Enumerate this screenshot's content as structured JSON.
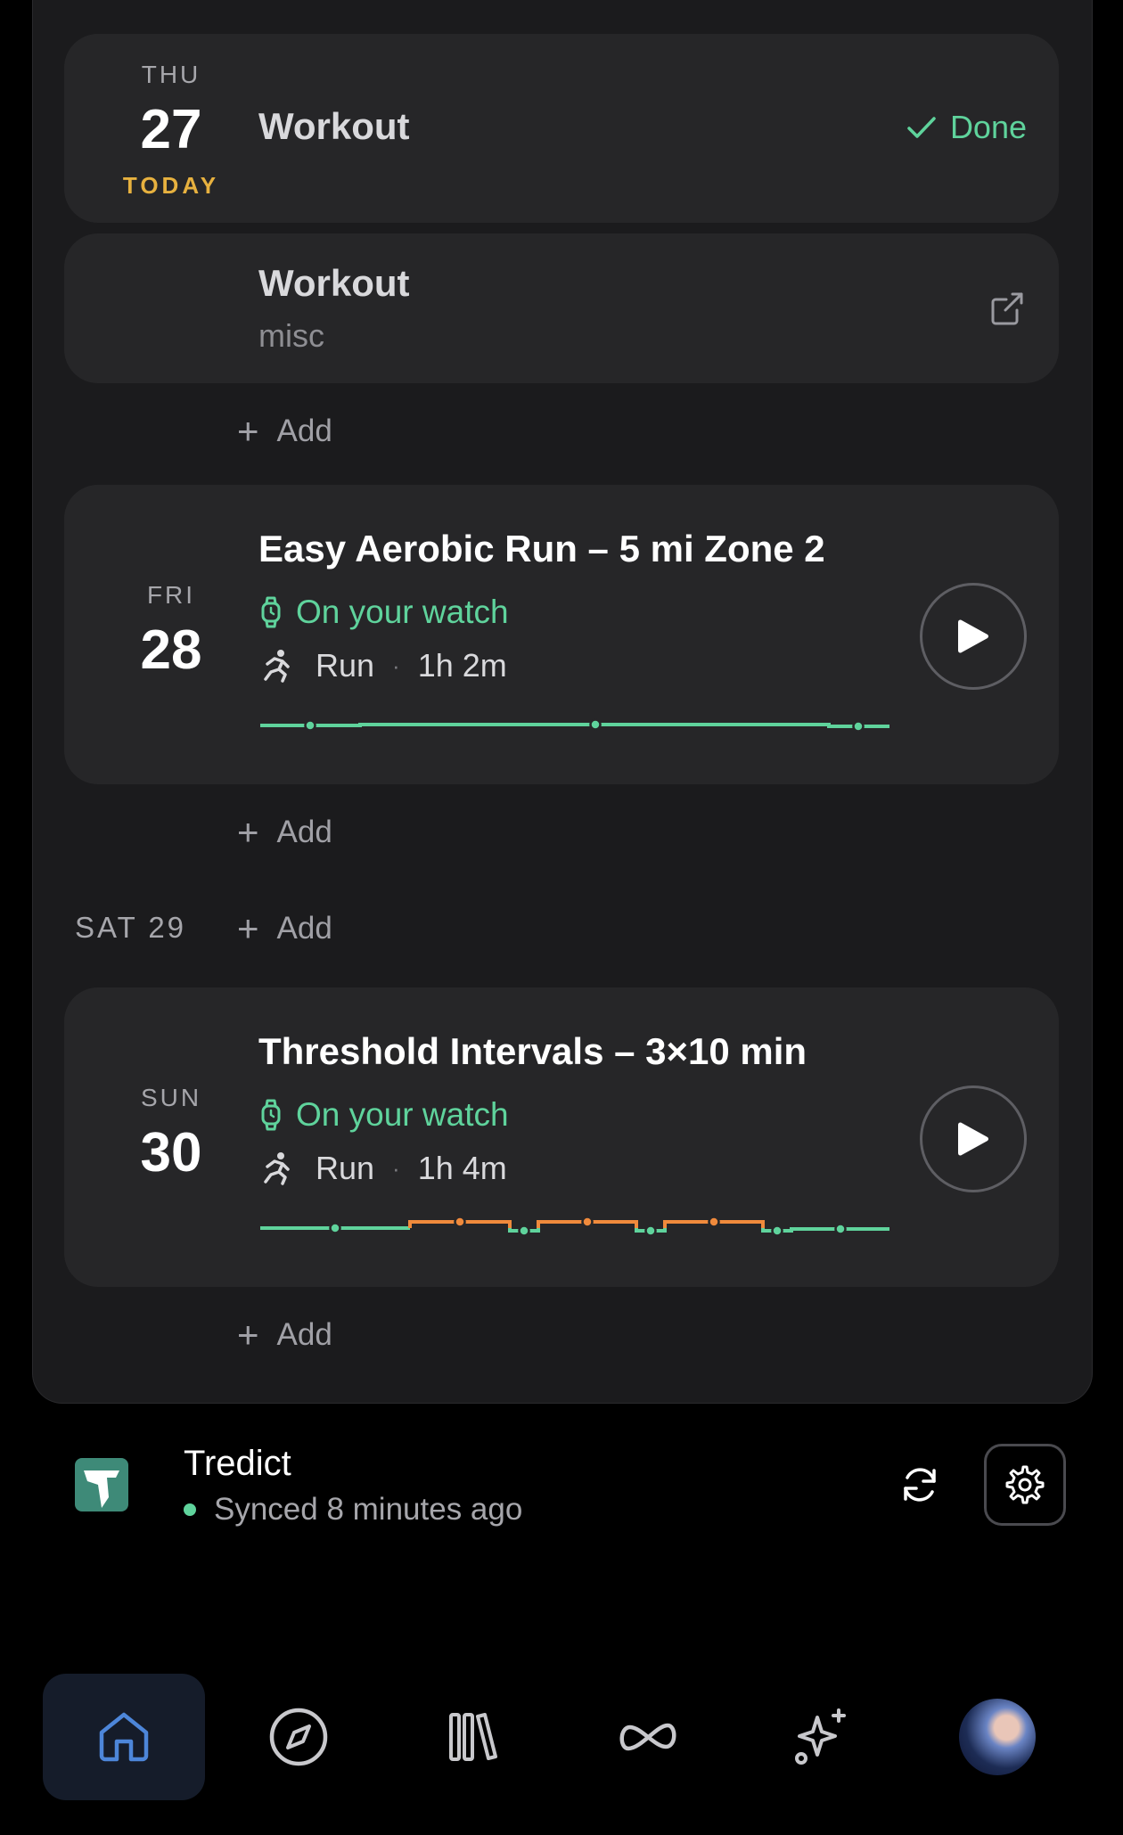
{
  "days": [
    {
      "day_label": "THU",
      "day_number": "27",
      "today_label": "TODAY",
      "items": [
        {
          "title": "Workout",
          "status": "Done"
        },
        {
          "title": "Workout",
          "subtitle": "misc",
          "icon": "external-link-icon"
        }
      ],
      "add_label": "Add"
    },
    {
      "day_label": "FRI",
      "day_number": "28",
      "workout": {
        "title": "Easy Aerobic Run – 5 mi Zone 2",
        "location": "On your watch",
        "sport": "Run",
        "duration": "1h 2m",
        "intensity_profile": [
          {
            "zone": "easy",
            "share": 0.16
          },
          {
            "zone": "easy",
            "share": 0.75
          },
          {
            "zone": "easy",
            "share": 0.09
          }
        ]
      },
      "add_label": "Add"
    },
    {
      "day_label": "SAT",
      "day_number": "29",
      "add_label": "Add"
    },
    {
      "day_label": "SUN",
      "day_number": "30",
      "workout": {
        "title": "Threshold Intervals – 3×10 min",
        "location": "On your watch",
        "sport": "Run",
        "duration": "1h 4m",
        "intensity_profile": [
          {
            "zone": "easy",
            "share": 0.24
          },
          {
            "zone": "threshold",
            "share": 0.16
          },
          {
            "zone": "easy",
            "share": 0.04
          },
          {
            "zone": "threshold",
            "share": 0.16
          },
          {
            "zone": "easy",
            "share": 0.04
          },
          {
            "zone": "threshold",
            "share": 0.16
          },
          {
            "zone": "easy",
            "share": 0.2
          }
        ]
      },
      "add_label": "Add"
    }
  ],
  "sync": {
    "app_name": "Tredict",
    "status": "Synced 8 minutes ago",
    "status_color": "#5fd39c"
  },
  "nav": [
    {
      "name": "home",
      "icon": "home-icon",
      "active": true
    },
    {
      "name": "explore",
      "icon": "compass-icon"
    },
    {
      "name": "library",
      "icon": "library-icon"
    },
    {
      "name": "integrations",
      "icon": "infinity-icon"
    },
    {
      "name": "ai",
      "icon": "sparkles-icon"
    },
    {
      "name": "profile",
      "icon": "avatar"
    }
  ],
  "colors": {
    "accent_green": "#5fd39c",
    "today_yellow": "#e7b13f",
    "threshold_orange": "#f08a3c",
    "card_bg": "#262628"
  }
}
